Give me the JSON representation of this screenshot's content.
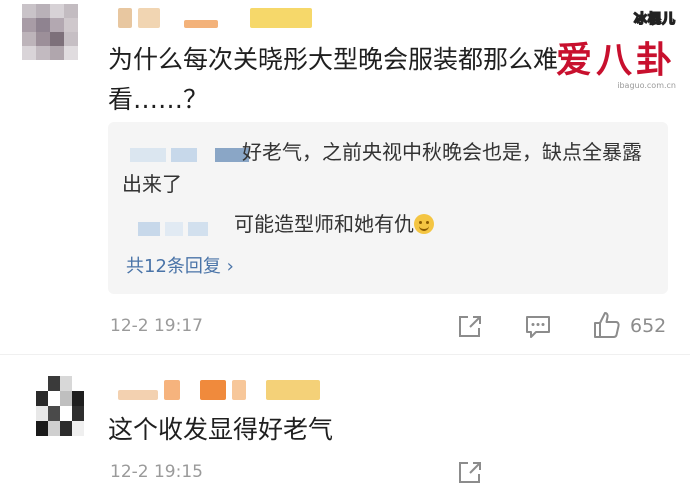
{
  "watermark": {
    "brand": "冰棍儿",
    "logo": "爱八卦",
    "url": "ibaguo.com.cn"
  },
  "comments": [
    {
      "text": "为什么每次关晓彤大型晚会服装都那么难看……？",
      "replies": [
        {
          "text": "好老气，之前央视中秋晚会也是，缺点全暴露出来了"
        },
        {
          "text": "可能造型师和她有仇",
          "emoji": "smile-emoji"
        }
      ],
      "more_replies": "共12条回复 ›",
      "timestamp": "12-2 19:17",
      "like_count": "652"
    },
    {
      "text": "这个收发显得好老气",
      "timestamp": "12-2 19:15"
    }
  ],
  "icons": {
    "share": "share-icon",
    "comment": "comment-icon",
    "like": "thumbs-up-icon"
  }
}
